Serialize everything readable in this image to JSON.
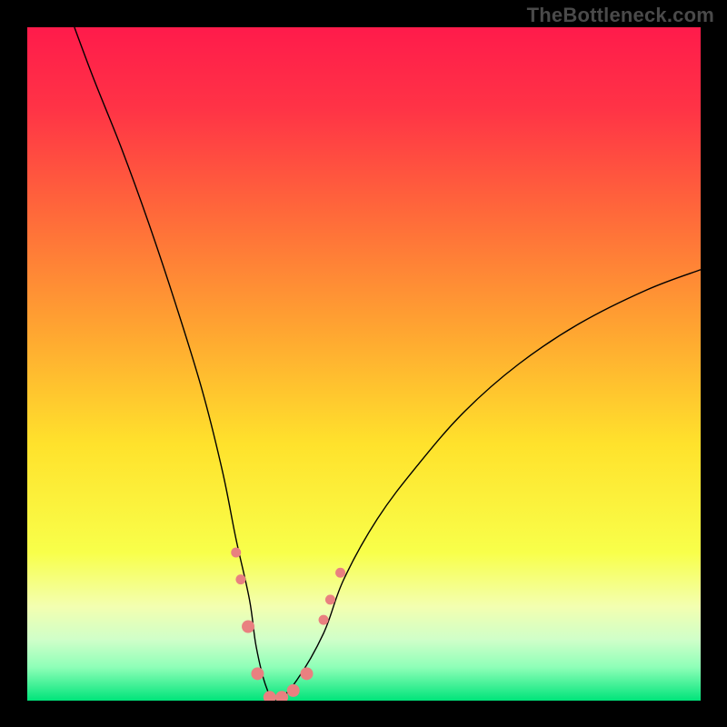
{
  "watermark": {
    "text": "TheBottleneck.com"
  },
  "chart_data": {
    "type": "line",
    "title": "",
    "xlabel": "",
    "ylabel": "",
    "xlim": [
      0,
      100
    ],
    "ylim": [
      0,
      100
    ],
    "grid": false,
    "legend": false,
    "background_gradient": {
      "stops": [
        {
          "pos": 0.0,
          "color": "#ff1b4b"
        },
        {
          "pos": 0.12,
          "color": "#ff3346"
        },
        {
          "pos": 0.28,
          "color": "#ff6a3a"
        },
        {
          "pos": 0.45,
          "color": "#ffa531"
        },
        {
          "pos": 0.62,
          "color": "#ffe22c"
        },
        {
          "pos": 0.78,
          "color": "#f8ff4a"
        },
        {
          "pos": 0.86,
          "color": "#f3ffb0"
        },
        {
          "pos": 0.91,
          "color": "#cfffc9"
        },
        {
          "pos": 0.95,
          "color": "#8fffb8"
        },
        {
          "pos": 1.0,
          "color": "#00e47a"
        }
      ]
    },
    "series": [
      {
        "name": "bottleneck-curve",
        "color": "#000000",
        "width": 1.4,
        "x": [
          7,
          10,
          14,
          18,
          22,
          26,
          29,
          31,
          33,
          34,
          35.5,
          37,
          40,
          44,
          47,
          52,
          58,
          65,
          73,
          82,
          92,
          100
        ],
        "y": [
          100,
          92,
          82,
          71,
          59,
          46,
          34,
          24,
          15,
          8,
          2,
          0,
          3,
          10,
          18,
          27,
          35,
          43,
          50,
          56,
          61,
          64
        ]
      }
    ],
    "markers": {
      "name": "highlight-points",
      "color": "#e98080",
      "radius_small": 5.5,
      "radius_large": 7,
      "points": [
        {
          "x": 31.0,
          "y": 22,
          "r": "small"
        },
        {
          "x": 31.7,
          "y": 18,
          "r": "small"
        },
        {
          "x": 32.8,
          "y": 11,
          "r": "large"
        },
        {
          "x": 34.2,
          "y": 4,
          "r": "large"
        },
        {
          "x": 36.0,
          "y": 0.5,
          "r": "large"
        },
        {
          "x": 37.8,
          "y": 0.5,
          "r": "large"
        },
        {
          "x": 39.5,
          "y": 1.5,
          "r": "large"
        },
        {
          "x": 41.5,
          "y": 4,
          "r": "large"
        },
        {
          "x": 44.0,
          "y": 12,
          "r": "small"
        },
        {
          "x": 45.0,
          "y": 15,
          "r": "small"
        },
        {
          "x": 46.5,
          "y": 19,
          "r": "small"
        }
      ]
    }
  }
}
